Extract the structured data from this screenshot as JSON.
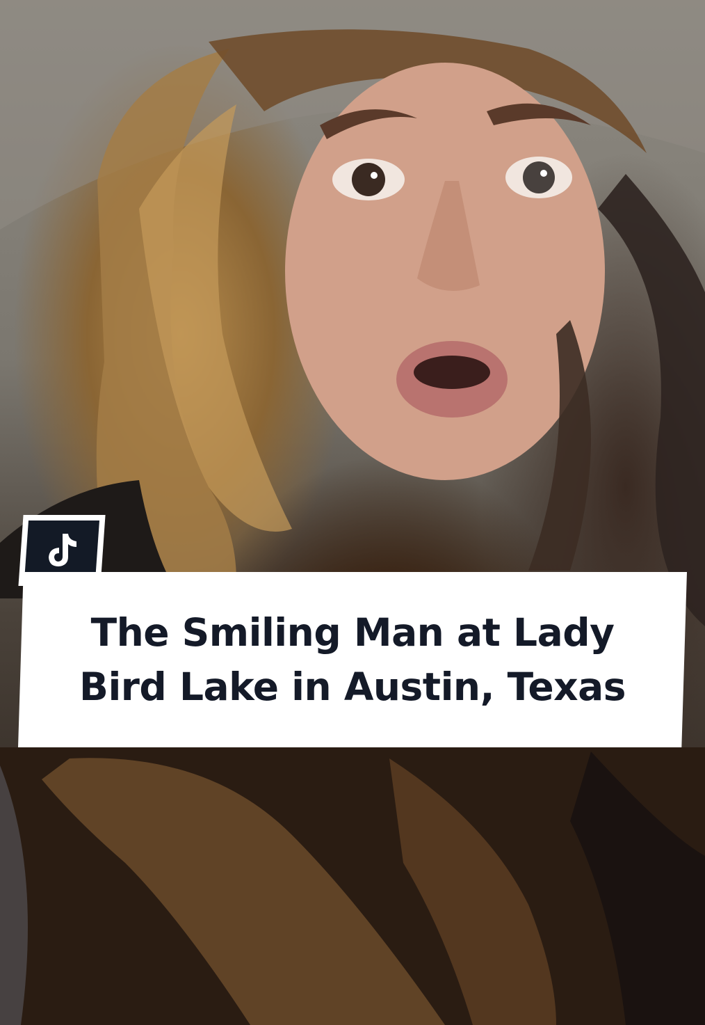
{
  "video": {
    "caption_line1": "The Smiling Man at Lady",
    "caption_line2": "Bird Lake in Austin, Texas",
    "logo_icon": "tiktok-logo-icon"
  },
  "colors": {
    "caption_bg": "#ffffff",
    "caption_text": "#141a28",
    "logo_bg": "#131a26",
    "logo_fg": "#ffffff"
  }
}
